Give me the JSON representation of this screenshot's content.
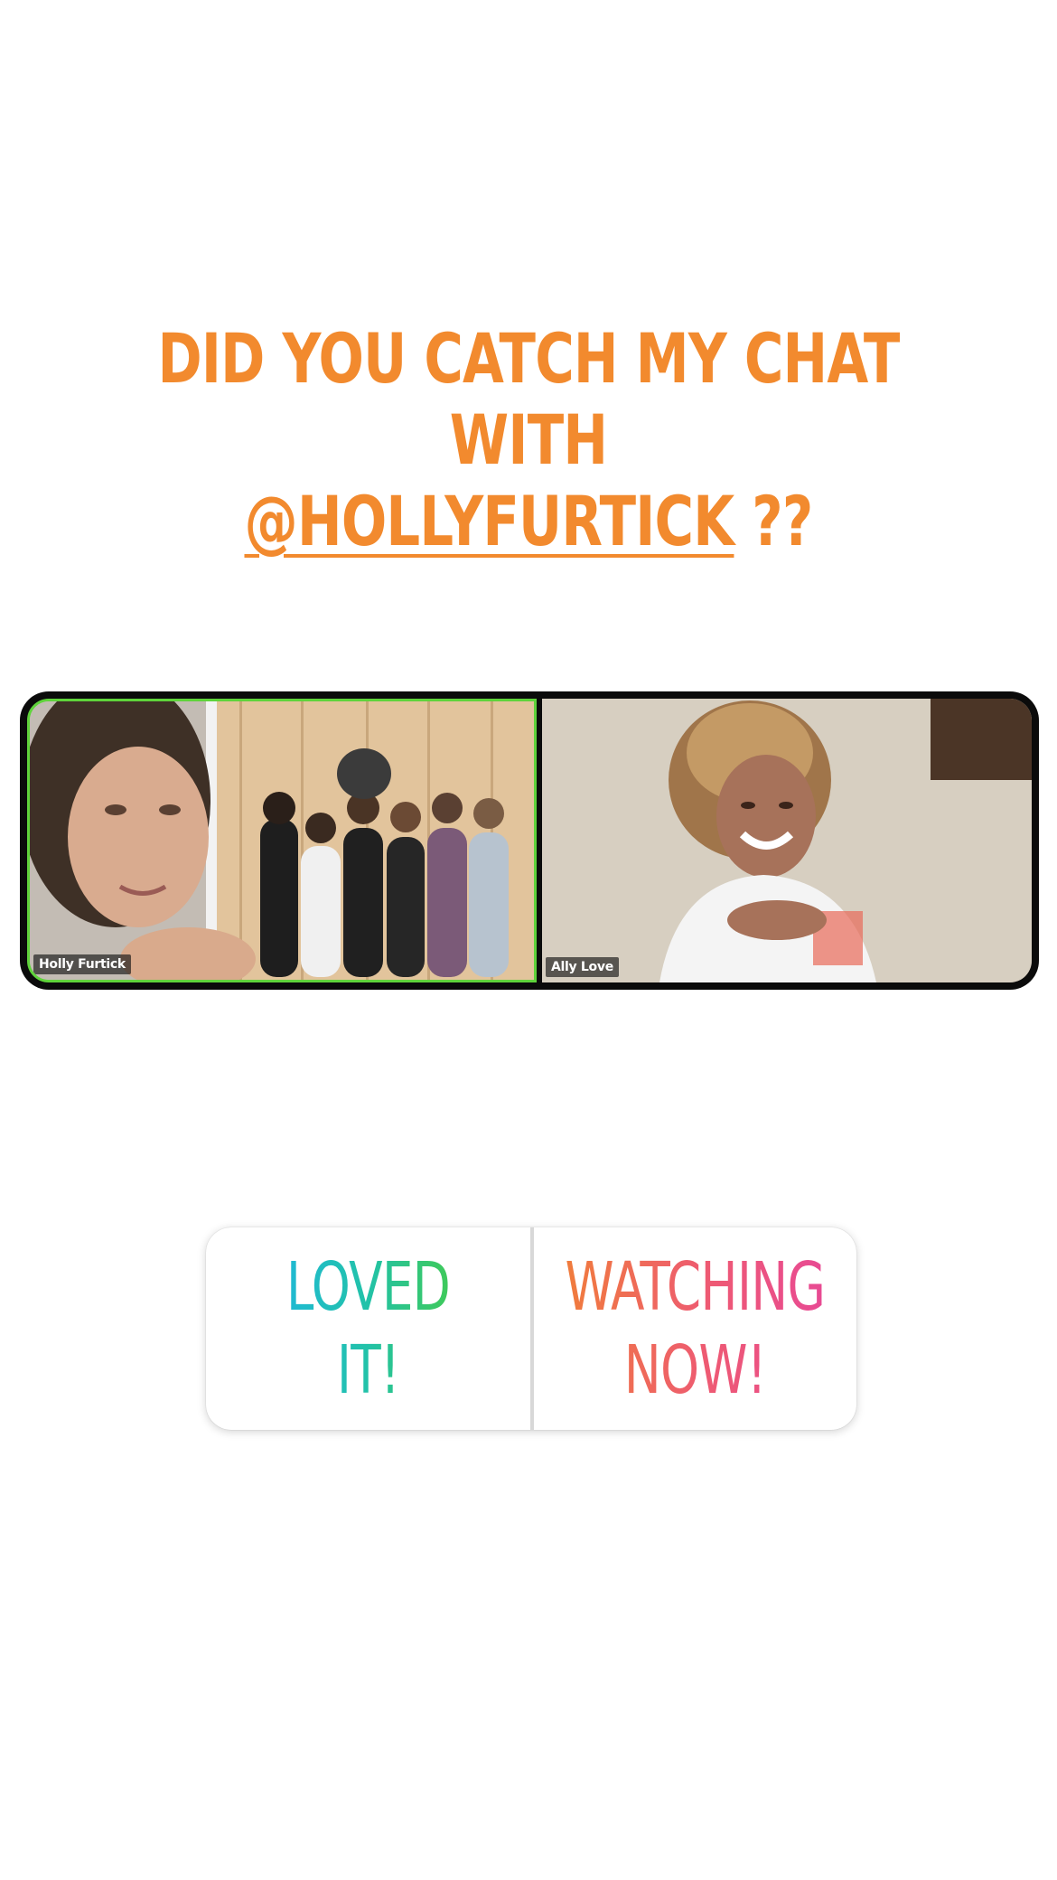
{
  "story": {
    "headline_line1": "DID YOU CATCH MY CHAT WITH",
    "headline_mention": "@HOLLYFURTICK",
    "headline_suffix": " ??",
    "accent_color": "#f28a2e"
  },
  "video_call": {
    "participants": [
      {
        "name": "Holly Furtick",
        "active_speaker": true,
        "highlight_color": "#5fd33b"
      },
      {
        "name": "Ally Love",
        "active_speaker": false
      }
    ]
  },
  "poll": {
    "option_a": "LOVED IT!",
    "option_b": "WATCHING\nNOW!",
    "option_a_gradient": [
      "#1fb6e6",
      "#4ccd35"
    ],
    "option_b_gradient": [
      "#f07c3c",
      "#e84a94"
    ]
  }
}
